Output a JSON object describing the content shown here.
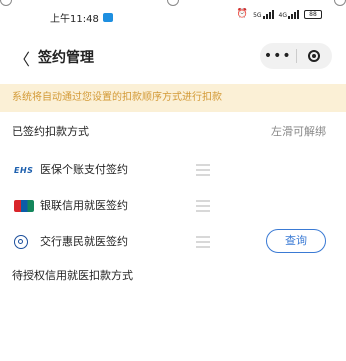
{
  "status_bar": {
    "time": "上午11:48",
    "signal_left_label": "5G",
    "signal_right_label": "4G",
    "battery": "88"
  },
  "header": {
    "title": "签约管理",
    "more_label": "•••"
  },
  "notice": {
    "text": "系统将自动通过您设置的扣款顺序方式进行扣款"
  },
  "signed_section": {
    "title": "已签约扣款方式",
    "hint": "左滑可解绑"
  },
  "methods": [
    {
      "icon_text": "EHS",
      "icon": "ehs-medical-insurance-icon",
      "label": "医保个账支付签约"
    },
    {
      "icon": "unionpay-icon",
      "label": "银联信用就医签约"
    },
    {
      "icon": "bocom-bank-icon",
      "label": "交行惠民就医签约",
      "action": "查询"
    }
  ],
  "pending_section": {
    "title": "待授权信用就医扣款方式"
  },
  "colors": {
    "notice_bg": "#fbf0d6",
    "notice_text": "#d39a37",
    "accent_blue": "#3a7ad4"
  }
}
